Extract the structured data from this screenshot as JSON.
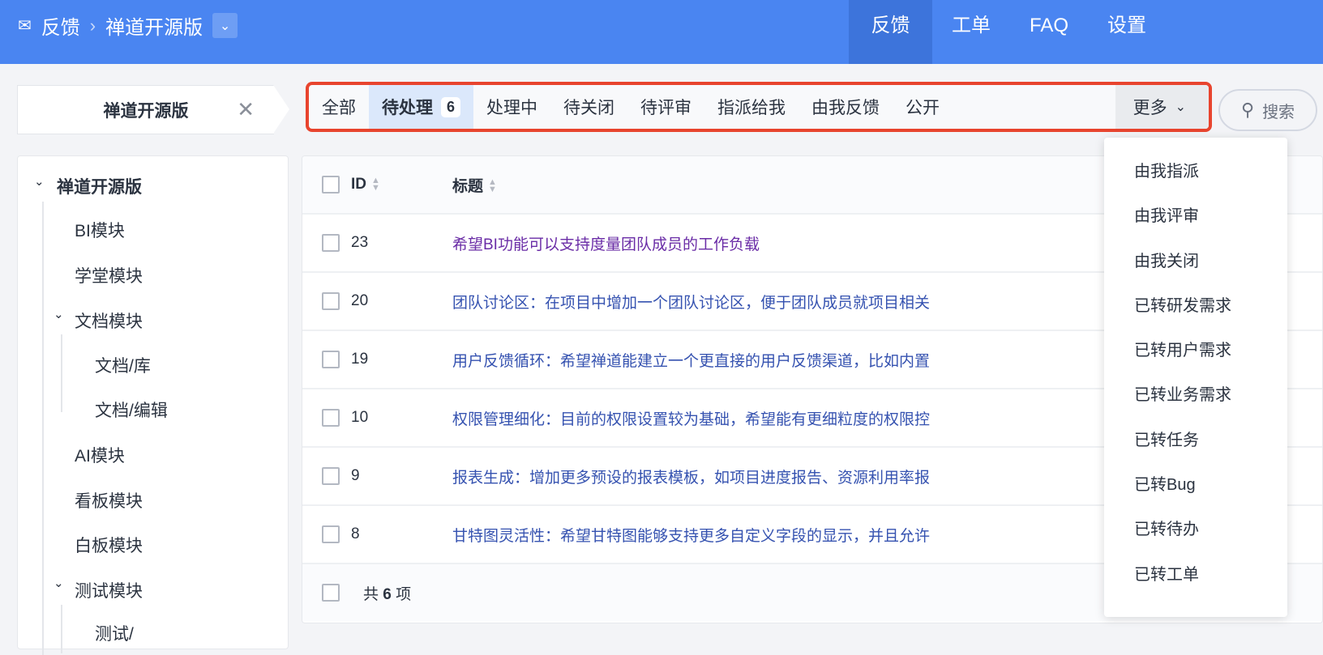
{
  "header": {
    "module": "反馈",
    "product": "禅道开源版",
    "nav": [
      "反馈",
      "工单",
      "FAQ",
      "设置"
    ]
  },
  "product_selector": {
    "label": "禅道开源版"
  },
  "tabs": {
    "all": "全部",
    "pending": "待处理",
    "pending_count": "6",
    "processing": "处理中",
    "to_close": "待关闭",
    "to_review": "待评审",
    "assigned_to_me": "指派给我",
    "reported_by_me": "由我反馈",
    "public": "公开",
    "more": "更多"
  },
  "search_label": "搜索",
  "more_menu": [
    "由我指派",
    "由我评审",
    "由我关闭",
    "已转研发需求",
    "已转用户需求",
    "已转业务需求",
    "已转任务",
    "已转Bug",
    "已转待办",
    "已转工单"
  ],
  "sidebar": {
    "root": "禅道开源版",
    "items": [
      "BI模块",
      "学堂模块",
      "文档模块",
      "文档/库",
      "文档/编辑",
      "AI模块",
      "看板模块",
      "白板模块",
      "测试模块",
      "测试/"
    ]
  },
  "table": {
    "columns": {
      "id": "ID",
      "title": "标题"
    },
    "rows": [
      {
        "id": "23",
        "title": "希望BI功能可以支持度量团队成员的工作负载",
        "visited": true
      },
      {
        "id": "20",
        "title": "团队讨论区：在项目中增加一个团队讨论区，便于团队成员就项目相关"
      },
      {
        "id": "19",
        "title": "用户反馈循环：希望禅道能建立一个更直接的用户反馈渠道，比如内置"
      },
      {
        "id": "10",
        "title": "权限管理细化：目前的权限设置较为基础，希望能有更细粒度的权限控"
      },
      {
        "id": "9",
        "title": "报表生成：增加更多预设的报表模板，如项目进度报告、资源利用率报"
      },
      {
        "id": "8",
        "title": "甘特图灵活性：希望甘特图能够支持更多自定义字段的显示，并且允许"
      }
    ],
    "footer": {
      "prefix": "共",
      "count": "6",
      "suffix": "项"
    }
  }
}
